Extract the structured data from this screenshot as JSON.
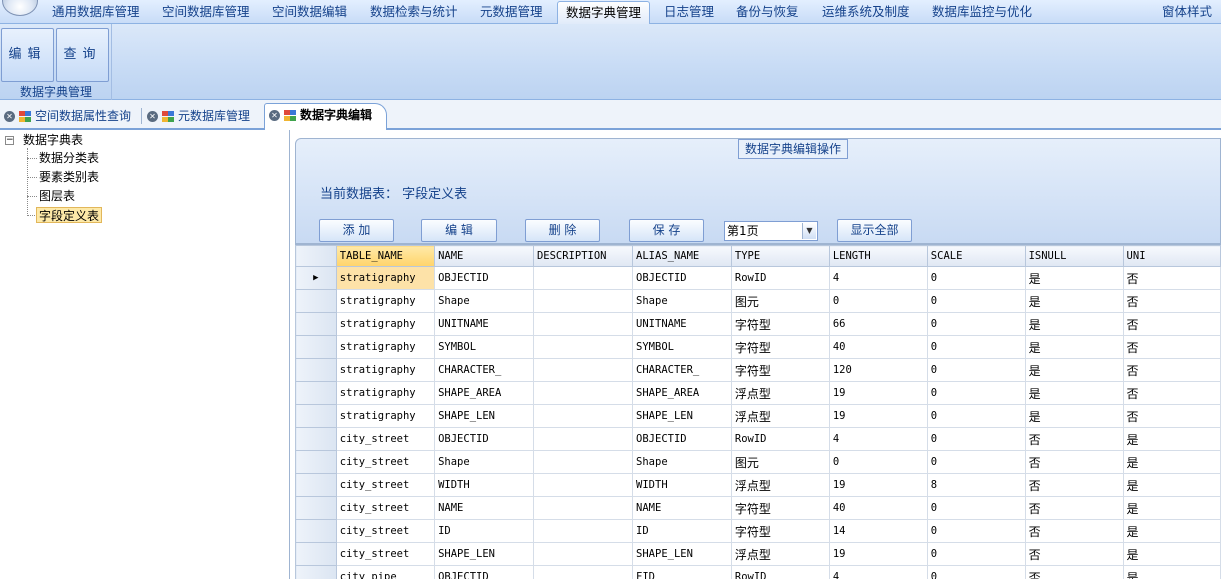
{
  "menu": {
    "items": [
      {
        "label": "通用数据库管理",
        "active": false
      },
      {
        "label": "空间数据库管理",
        "active": false
      },
      {
        "label": "空间数据编辑",
        "active": false
      },
      {
        "label": "数据检索与统计",
        "active": false
      },
      {
        "label": "元数据管理",
        "active": false
      },
      {
        "label": "数据字典管理",
        "active": true
      },
      {
        "label": "日志管理",
        "active": false
      },
      {
        "label": "备份与恢复",
        "active": false
      },
      {
        "label": "运维系统及制度",
        "active": false
      },
      {
        "label": "数据库监控与优化",
        "active": false
      }
    ],
    "right_label": "窗体样式"
  },
  "ribbon": {
    "edit_label": "编辑",
    "query_label": "查询",
    "group_label": "数据字典管理"
  },
  "tabs": [
    {
      "label": "空间数据属性查询",
      "active": false
    },
    {
      "label": "元数据库管理",
      "active": false
    },
    {
      "label": "数据字典编辑",
      "active": true
    }
  ],
  "tree": {
    "root": "数据字典表",
    "toggle": "−",
    "children": [
      "数据分类表",
      "要素类别表",
      "图层表",
      "字段定义表"
    ],
    "selected_index": 3
  },
  "panel": {
    "title": "数据字典编辑操作",
    "current_table_label": "当前数据表：",
    "current_table_value": "字段定义表",
    "buttons": {
      "add": "添 加",
      "edit": "编 辑",
      "delete": "删 除",
      "save": "保 存",
      "show_all": "显示全部"
    },
    "page_value": "第1页"
  },
  "grid": {
    "columns": [
      "TABLE_NAME",
      "NAME",
      "DESCRIPTION",
      "ALIAS_NAME",
      "TYPE",
      "LENGTH",
      "SCALE",
      "ISNULL",
      "UNI"
    ],
    "current_row": 0,
    "current_row_marker": "▶",
    "rows": [
      [
        "stratigraphy",
        "OBJECTID",
        "",
        "OBJECTID",
        "RowID",
        "4",
        "0",
        "是",
        "否"
      ],
      [
        "stratigraphy",
        "Shape",
        "",
        "Shape",
        "图元",
        "0",
        "0",
        "是",
        "否"
      ],
      [
        "stratigraphy",
        "UNITNAME",
        "",
        "UNITNAME",
        "字符型",
        "66",
        "0",
        "是",
        "否"
      ],
      [
        "stratigraphy",
        "SYMBOL",
        "",
        "SYMBOL",
        "字符型",
        "40",
        "0",
        "是",
        "否"
      ],
      [
        "stratigraphy",
        "CHARACTER_",
        "",
        "CHARACTER_",
        "字符型",
        "120",
        "0",
        "是",
        "否"
      ],
      [
        "stratigraphy",
        "SHAPE_AREA",
        "",
        "SHAPE_AREA",
        "浮点型",
        "19",
        "0",
        "是",
        "否"
      ],
      [
        "stratigraphy",
        "SHAPE_LEN",
        "",
        "SHAPE_LEN",
        "浮点型",
        "19",
        "0",
        "是",
        "否"
      ],
      [
        "city_street",
        "OBJECTID",
        "",
        "OBJECTID",
        "RowID",
        "4",
        "0",
        "否",
        "是"
      ],
      [
        "city_street",
        "Shape",
        "",
        "Shape",
        "图元",
        "0",
        "0",
        "否",
        "是"
      ],
      [
        "city_street",
        "WIDTH",
        "",
        "WIDTH",
        "浮点型",
        "19",
        "8",
        "否",
        "是"
      ],
      [
        "city_street",
        "NAME",
        "",
        "NAME",
        "字符型",
        "40",
        "0",
        "否",
        "是"
      ],
      [
        "city_street",
        "ID",
        "",
        "ID",
        "字符型",
        "14",
        "0",
        "否",
        "是"
      ],
      [
        "city_street",
        "SHAPE_LEN",
        "",
        "SHAPE_LEN",
        "浮点型",
        "19",
        "0",
        "否",
        "是"
      ],
      [
        "city_pipe",
        "OBJECTID",
        "",
        "FID",
        "RowID",
        "4",
        "0",
        "否",
        "是"
      ]
    ]
  },
  "colors": {
    "accent": "#15428b",
    "ribbon": "#c7dbf5",
    "selection": "#fde2a8"
  }
}
